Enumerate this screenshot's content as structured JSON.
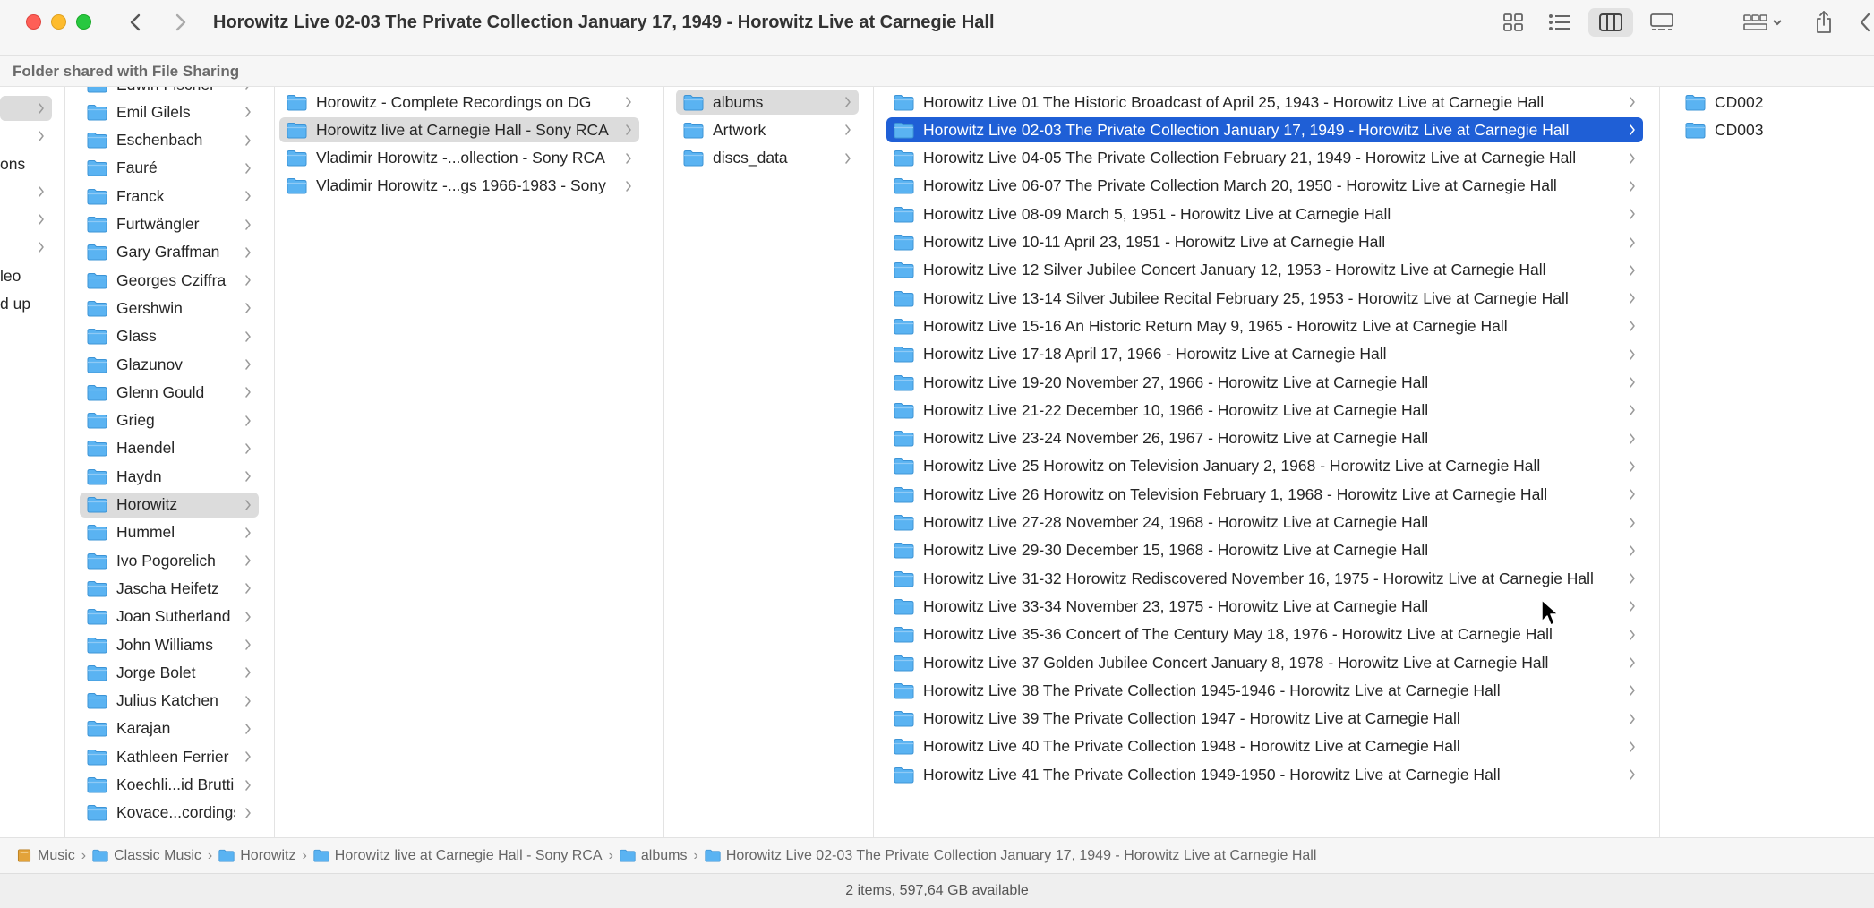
{
  "window": {
    "title": "Horowitz Live 02-03 The Private Collection January 17, 1949 - Horowitz Live at Carnegie Hall",
    "shared_banner": "Folder shared with File Sharing"
  },
  "toolbar": {
    "icons": [
      "back-icon",
      "forward-icon",
      "icon-view-icon",
      "list-view-icon",
      "column-view-icon",
      "gallery-view-icon",
      "group-icon",
      "share-icon",
      "more-icon"
    ],
    "active_view": "column-view"
  },
  "colors": {
    "accent": "#1f5fd6",
    "folder": "#5ab3f2",
    "selection_inactive": "#dcdcdc"
  },
  "columns": {
    "col0": [
      {
        "label": "ons"
      },
      {
        "label": "leo"
      },
      {
        "label": "d up"
      }
    ],
    "col1": [
      {
        "label": "Edwin Fischer"
      },
      {
        "label": "Emil Gilels"
      },
      {
        "label": "Eschenbach"
      },
      {
        "label": "Fauré"
      },
      {
        "label": "Franck"
      },
      {
        "label": "Furtwängler"
      },
      {
        "label": "Gary Graffman"
      },
      {
        "label": "Georges Cziffra"
      },
      {
        "label": "Gershwin"
      },
      {
        "label": "Glass"
      },
      {
        "label": "Glazunov"
      },
      {
        "label": "Glenn Gould"
      },
      {
        "label": "Grieg"
      },
      {
        "label": "Haendel"
      },
      {
        "label": "Haydn"
      },
      {
        "label": "Horowitz",
        "selected": true
      },
      {
        "label": "Hummel"
      },
      {
        "label": "Ivo Pogorelich"
      },
      {
        "label": "Jascha Heifetz"
      },
      {
        "label": "Joan Sutherland"
      },
      {
        "label": "John Williams"
      },
      {
        "label": "Jorge Bolet"
      },
      {
        "label": "Julius Katchen"
      },
      {
        "label": "Karajan"
      },
      {
        "label": "Kathleen Ferrier"
      },
      {
        "label": "Koechli...id Brutti"
      },
      {
        "label": "Kovace...cordings"
      }
    ],
    "col2": [
      {
        "label": "Horowitz - Complete Recordings on DG"
      },
      {
        "label": "Horowitz live at Carnegie Hall - Sony RCA",
        "selected": true
      },
      {
        "label": "Vladimir Horowitz -...ollection - Sony RCA"
      },
      {
        "label": "Vladimir Horowitz -...gs 1966-1983 - Sony"
      }
    ],
    "col3": [
      {
        "label": "albums",
        "selected": true
      },
      {
        "label": "Artwork"
      },
      {
        "label": "discs_data"
      }
    ],
    "col4": [
      {
        "label": "Horowitz Live 01 The Historic Broadcast of April 25, 1943 - Horowitz Live at Carnegie Hall"
      },
      {
        "label": "Horowitz Live 02-03 The Private Collection January 17, 1949 - Horowitz Live at Carnegie Hall",
        "selected": true
      },
      {
        "label": "Horowitz Live 04-05 The Private Collection February 21, 1949 - Horowitz Live at Carnegie Hall"
      },
      {
        "label": "Horowitz Live 06-07 The Private Collection March 20, 1950 - Horowitz Live at Carnegie Hall"
      },
      {
        "label": "Horowitz Live 08-09 March 5, 1951 - Horowitz Live at Carnegie Hall"
      },
      {
        "label": "Horowitz Live 10-11 April 23, 1951 - Horowitz Live at Carnegie Hall"
      },
      {
        "label": "Horowitz Live 12 Silver Jubilee Concert January 12, 1953 - Horowitz Live at Carnegie Hall"
      },
      {
        "label": "Horowitz Live 13-14 Silver Jubilee Recital February 25, 1953 - Horowitz Live at Carnegie Hall"
      },
      {
        "label": "Horowitz Live 15-16 An Historic Return May 9, 1965 - Horowitz Live at Carnegie Hall"
      },
      {
        "label": "Horowitz Live 17-18 April 17, 1966 - Horowitz Live at Carnegie Hall"
      },
      {
        "label": "Horowitz Live 19-20 November 27, 1966 - Horowitz Live at Carnegie Hall"
      },
      {
        "label": "Horowitz Live 21-22 December 10, 1966 - Horowitz Live at Carnegie Hall"
      },
      {
        "label": "Horowitz Live 23-24 November 26, 1967 - Horowitz Live at Carnegie Hall"
      },
      {
        "label": "Horowitz Live 25 Horowitz on Television January 2, 1968 - Horowitz Live at Carnegie Hall"
      },
      {
        "label": "Horowitz Live 26 Horowitz on Television February 1, 1968 - Horowitz Live at Carnegie Hall"
      },
      {
        "label": "Horowitz Live 27-28 November 24, 1968 - Horowitz Live at Carnegie Hall"
      },
      {
        "label": "Horowitz Live 29-30 December 15, 1968 - Horowitz Live at Carnegie Hall"
      },
      {
        "label": "Horowitz Live 31-32 Horowitz Rediscovered November 16, 1975 - Horowitz Live at Carnegie Hall"
      },
      {
        "label": "Horowitz Live 33-34 November 23, 1975 - Horowitz Live at Carnegie Hall"
      },
      {
        "label": "Horowitz Live 35-36 Concert of The Century May 18, 1976 - Horowitz Live at Carnegie Hall"
      },
      {
        "label": "Horowitz Live 37 Golden Jubilee Concert January 8, 1978 - Horowitz Live at Carnegie Hall"
      },
      {
        "label": "Horowitz Live 38 The Private Collection 1945-1946 - Horowitz Live at Carnegie Hall"
      },
      {
        "label": "Horowitz Live 39 The Private Collection 1947 - Horowitz Live at Carnegie Hall"
      },
      {
        "label": "Horowitz Live 40 The Private Collection 1948 - Horowitz Live at Carnegie Hall"
      },
      {
        "label": "Horowitz Live 41 The Private Collection 1949-1950 - Horowitz Live at Carnegie Hall"
      }
    ],
    "col5": [
      {
        "label": "CD002"
      },
      {
        "label": "CD003"
      }
    ]
  },
  "pathbar": [
    {
      "label": "Music",
      "icon": "music-drive-icon"
    },
    {
      "label": "Classic Music",
      "icon": "folder-icon"
    },
    {
      "label": "Horowitz",
      "icon": "folder-icon"
    },
    {
      "label": "Horowitz live at Carnegie Hall - Sony RCA",
      "icon": "folder-icon"
    },
    {
      "label": "albums",
      "icon": "folder-icon"
    },
    {
      "label": "Horowitz Live 02-03 The Private Collection January 17, 1949 - Horowitz Live at Carnegie Hall",
      "icon": "folder-icon"
    }
  ],
  "status": {
    "text": "2 items, 597,64 GB available"
  }
}
